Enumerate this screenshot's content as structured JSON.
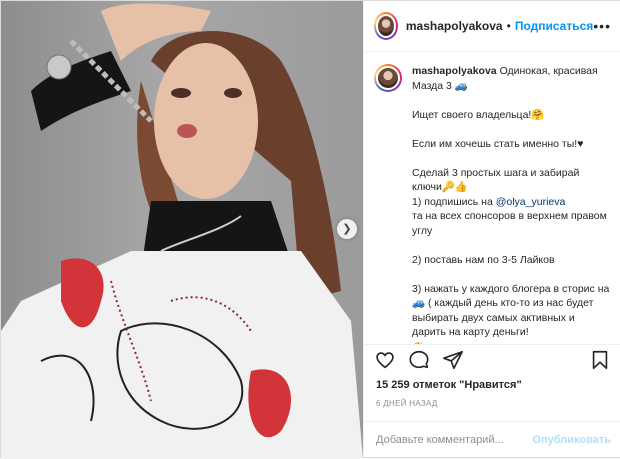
{
  "post": {
    "username": "mashapolyakova",
    "dot": "•",
    "follow_label": "Подписаться",
    "more_label": "•••"
  },
  "caption": {
    "username": "mashapolyakova",
    "lines": [
      "Одинокая, красивая Мазда 3 🚙",
      "",
      "Ищет своего владельца!🤗",
      "",
      "Если им хочешь стать именно ты!♥",
      "",
      "Сделай 3 простых шага и забирай ключи🔑👍",
      "1) подпишись на ",
      "та на всех спонсоров в верхнем правом углу",
      "",
      "2) поставь нам по 3-5 Лайков",
      "",
      "3) нажать у каждого блогера в сторис на 🚙 ( каждый день кто-то из нас будет выбирать двух самых активных и дарить на карту деньги!",
      "👏"
    ],
    "mention": "@olya_yurieva"
  },
  "actions": {
    "like_icon": "heart-icon",
    "comment_icon": "comment-icon",
    "share_icon": "share-icon",
    "save_icon": "bookmark-icon"
  },
  "likes_text": "15 259 отметок \"Нравится\"",
  "time_text": "6 ДНЕЙ НАЗАД",
  "comment": {
    "placeholder": "Добавьте комментарий...",
    "publish_label": "Опубликовать"
  },
  "colors": {
    "accent": "#0095f6",
    "publish_disabled": "#b2dffc"
  }
}
